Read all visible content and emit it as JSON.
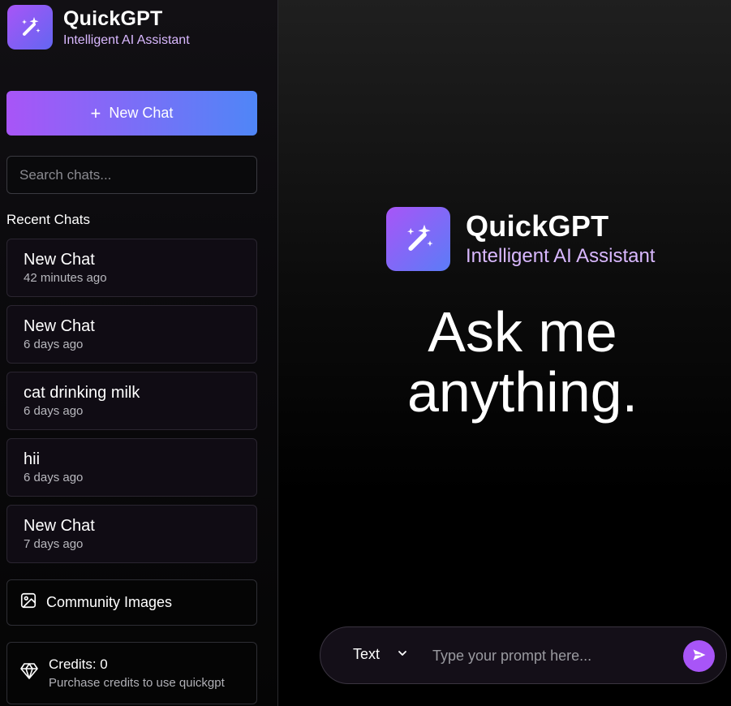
{
  "brand": {
    "title": "QuickGPT",
    "subtitle": "Intelligent AI Assistant",
    "icon": "magic-wand-icon",
    "colors": {
      "accent_purple": "#a855f7",
      "accent_blue": "#4f86f7",
      "subtitle": "#d9b8ff"
    }
  },
  "sidebar": {
    "new_chat_label": "New Chat",
    "search_placeholder": "Search chats...",
    "recent_label": "Recent Chats",
    "chats": [
      {
        "title": "New Chat",
        "time": "42 minutes ago"
      },
      {
        "title": "New Chat",
        "time": "6 days ago"
      },
      {
        "title": "cat drinking milk",
        "time": "6 days ago"
      },
      {
        "title": "hii",
        "time": "6 days ago"
      },
      {
        "title": "New Chat",
        "time": "7 days ago"
      }
    ],
    "community_label": "Community Images",
    "credits_title": "Credits: 0",
    "credits_sub": "Purchase credits to use quickgpt"
  },
  "main": {
    "headline_line1": "Ask me",
    "headline_line2": "anything.",
    "mode": "Text",
    "prompt_placeholder": "Type your prompt here..."
  }
}
